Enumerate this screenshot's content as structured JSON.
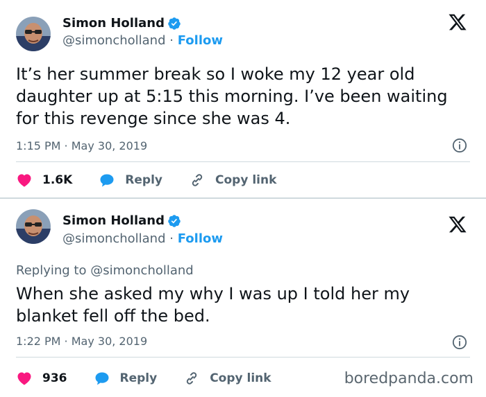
{
  "tweets": [
    {
      "author": {
        "name": "Simon Holland",
        "handle": "@simoncholland",
        "follow_label": "Follow"
      },
      "reply_to": "",
      "text": "It’s her summer break so I woke my 12 year old daughter up at 5:15 this morning. I’ve been waiting for this revenge since she was 4.",
      "time": "1:15 PM · May 30, 2019",
      "likes": "1.6K",
      "reply_label": "Reply",
      "copy_label": "Copy link"
    },
    {
      "author": {
        "name": "Simon Holland",
        "handle": "@simoncholland",
        "follow_label": "Follow"
      },
      "reply_to_prefix": "Replying to",
      "reply_to": "@simoncholland",
      "text": "When she asked my why I was up I told her my blanket fell off the bed.",
      "time": "1:22 PM · May 30, 2019",
      "likes": "936",
      "reply_label": "Reply",
      "copy_label": "Copy link"
    }
  ],
  "watermark": "boredpanda.com",
  "colors": {
    "accent": "#1d9bf0",
    "like": "#f91880",
    "muted": "#536471",
    "text": "#0f1419"
  }
}
